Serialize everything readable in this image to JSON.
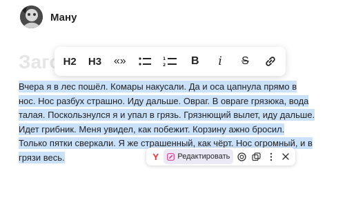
{
  "author": {
    "name": "Ману",
    "avatar_icon": "user-avatar"
  },
  "title_placeholder": "Заголовок",
  "toolbar": {
    "h2": "H2",
    "h3": "H3",
    "quote": "«»",
    "bold": "B",
    "italic": "i",
    "strike": "S"
  },
  "paragraph": "Вчера я в лес пошёл. Комары накусали. Да и оса цапнула прямо в нос. Нос разбух страшно. Иду дальше. Овраг. В овраге грязюка, вода талая. Поскользнулся я и упал в грязь. Грязнющий вылет, иду дальше. Идет грибник. Меня увидел, как побежит. Корзину ажно бросил. Только пятки сверкали. Я же страшенный, как чёрт. Нос огромный, и в грязи весь.",
  "selection_bar": {
    "yandex": "Y",
    "edit_label": "Редактировать"
  },
  "colors": {
    "selection": "#c9e1fb",
    "yandex_red": "#ff2a2a",
    "edit_bg": "#ece9f6"
  }
}
